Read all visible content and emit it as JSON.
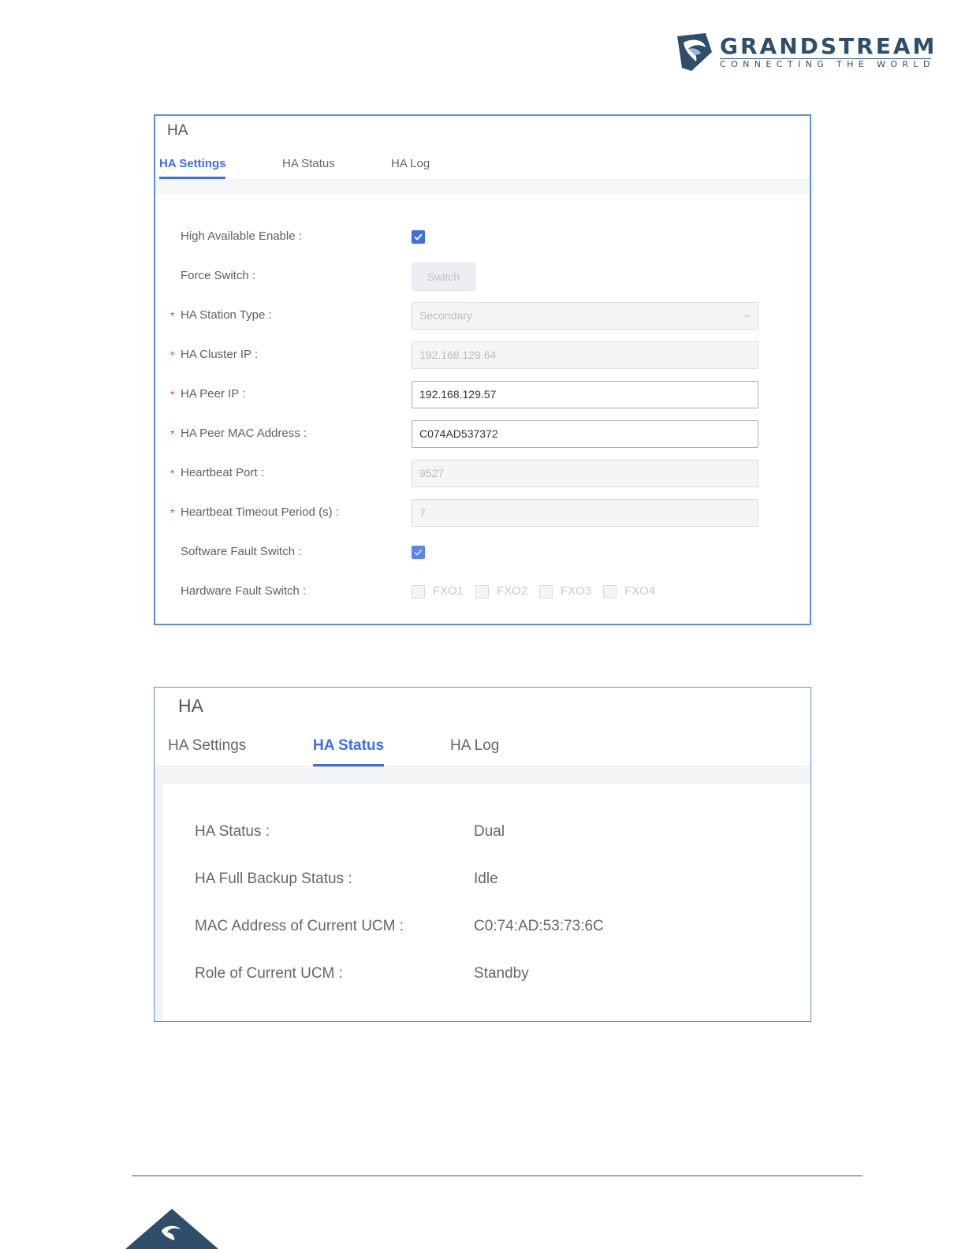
{
  "brand": {
    "name": "GRANDSTREAM",
    "tagline": "CONNECTING THE WORLD",
    "color": "#2f4e6a",
    "accent": "#3d6ee5"
  },
  "settings_panel": {
    "title": "HA",
    "tabs": [
      {
        "label": "HA Settings",
        "active": true
      },
      {
        "label": "HA Status",
        "active": false
      },
      {
        "label": "HA Log",
        "active": false
      }
    ],
    "fields": {
      "high_available_enable": {
        "label": "High Available Enable :",
        "checked": true
      },
      "force_switch": {
        "label": "Force Switch :",
        "button": "Switch"
      },
      "station_type": {
        "label": "HA Station Type :",
        "value": "Secondary",
        "required": true
      },
      "cluster_ip": {
        "label": "HA Cluster IP :",
        "value": "192.168.129.64",
        "required": true
      },
      "peer_ip": {
        "label": "HA Peer IP :",
        "value": "192.168.129.57",
        "required": true
      },
      "peer_mac": {
        "label": "HA Peer MAC Address :",
        "value": "C074AD537372",
        "required": true
      },
      "heartbeat_port": {
        "label": "Heartbeat Port :",
        "value": "9527",
        "required": true
      },
      "heartbeat_timeout": {
        "label": "Heartbeat Timeout Period (s) :",
        "value": "7",
        "required": true
      },
      "software_fault": {
        "label": "Software Fault Switch :",
        "checked": true
      },
      "hardware_fault": {
        "label": "Hardware Fault Switch :",
        "options": [
          {
            "label": "FXO1",
            "checked": false
          },
          {
            "label": "FXO2",
            "checked": false
          },
          {
            "label": "FXO3",
            "checked": false
          },
          {
            "label": "FXO4",
            "checked": false
          }
        ]
      }
    },
    "required_mark": "*"
  },
  "status_panel": {
    "title": "HA",
    "tabs": [
      {
        "label": "HA Settings",
        "active": false
      },
      {
        "label": "HA Status",
        "active": true
      },
      {
        "label": "HA Log",
        "active": false
      }
    ],
    "rows": [
      {
        "label": "HA Status :",
        "value": "Dual"
      },
      {
        "label": "HA Full Backup Status :",
        "value": "Idle"
      },
      {
        "label": "MAC Address of Current UCM :",
        "value": "C0:74:AD:53:73:6C"
      },
      {
        "label": "Role of Current UCM :",
        "value": "Standby"
      }
    ]
  }
}
